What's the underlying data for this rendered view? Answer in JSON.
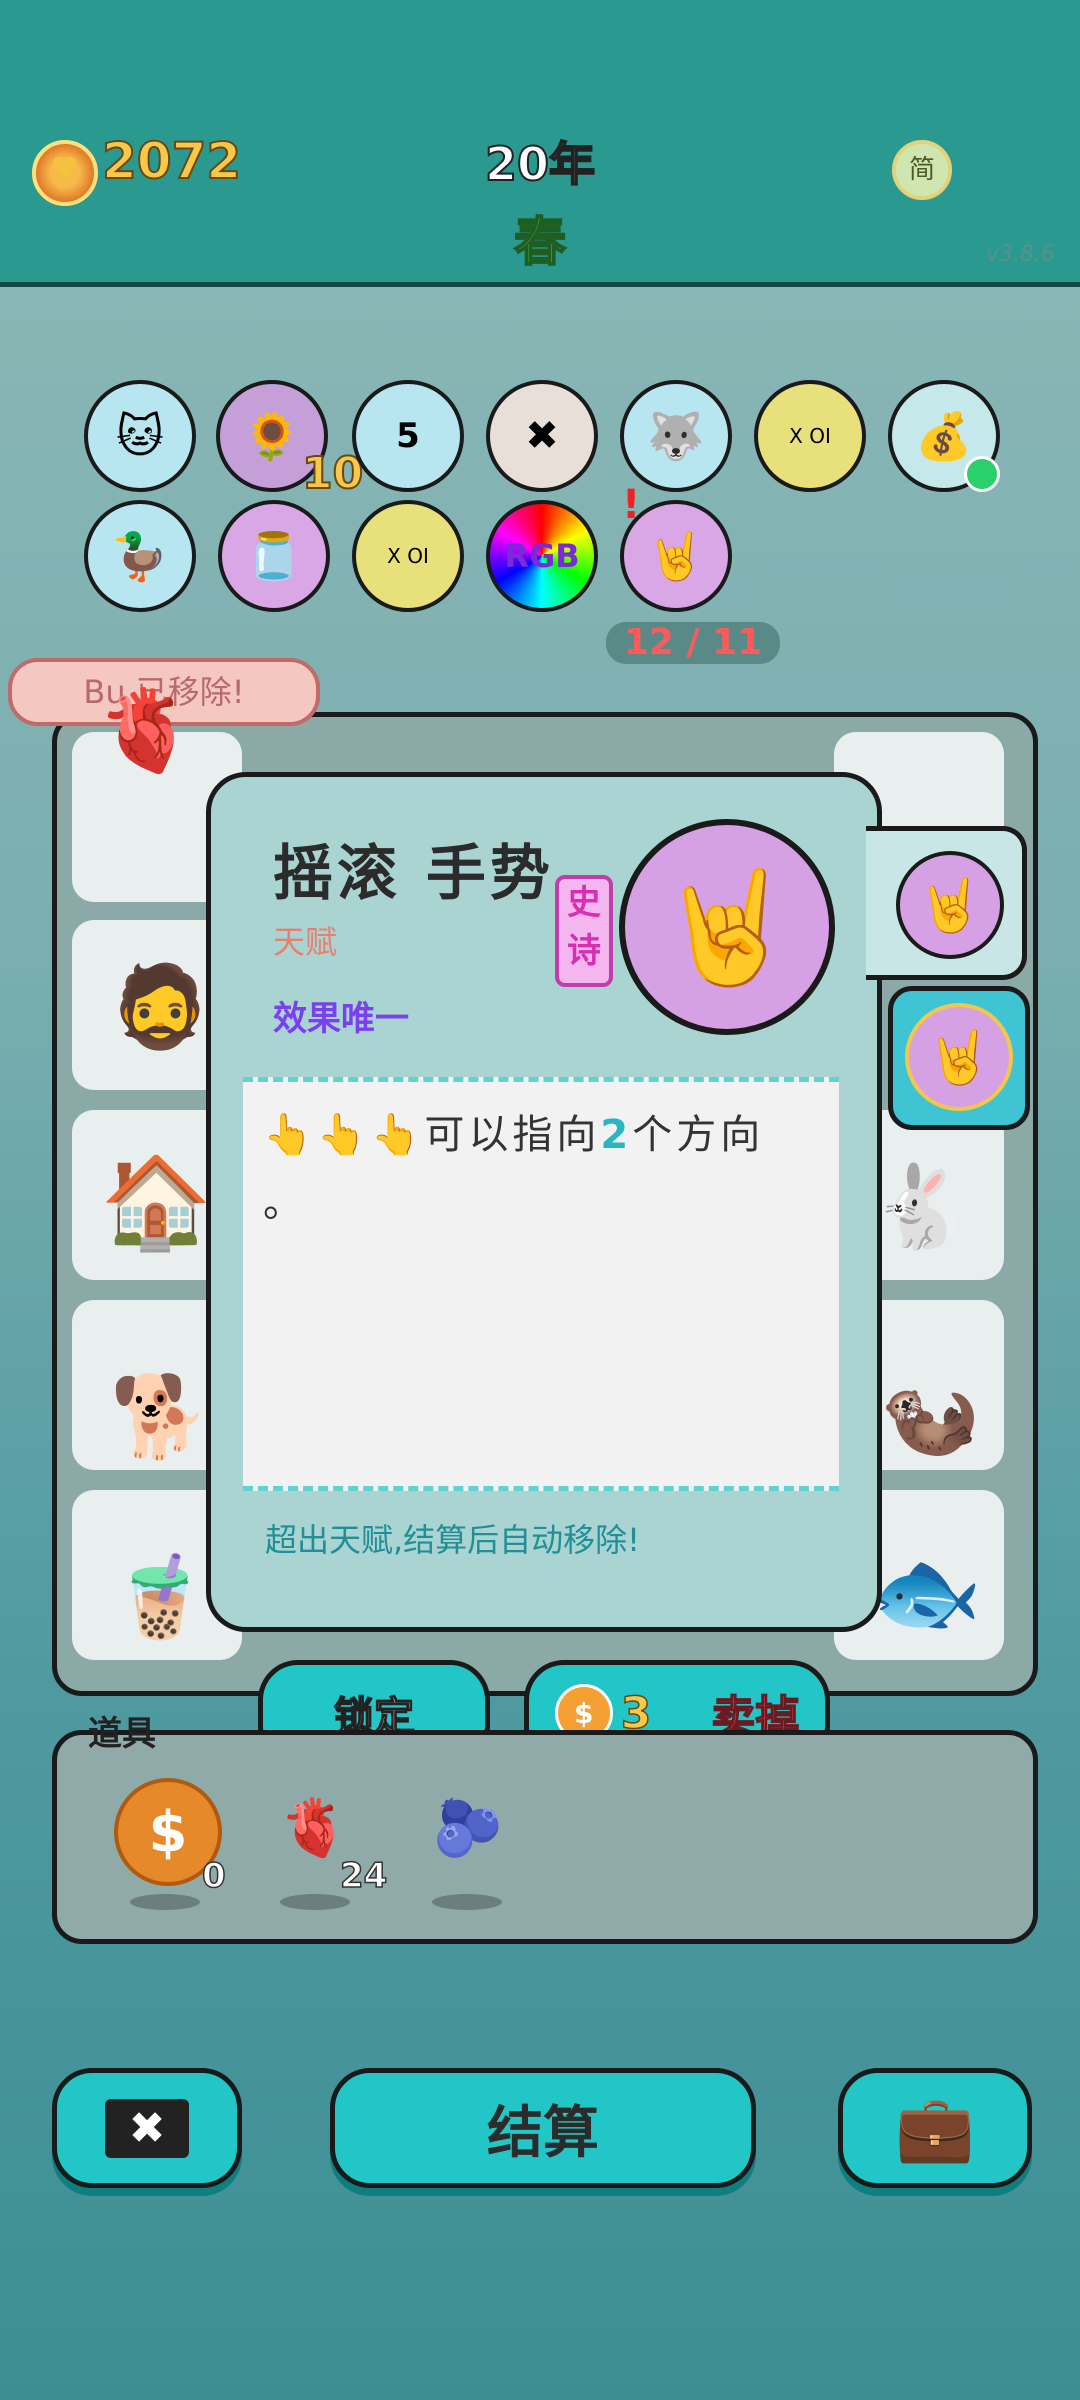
{
  "header": {
    "coins": "2072",
    "year": "20年",
    "season": "春",
    "lang_toggle": "简",
    "version": "v3.8.6"
  },
  "relics": {
    "row1": [
      {
        "icon": "sunflower-cat-icon",
        "glyph": "🐱"
      },
      {
        "icon": "sunflower-cats-icon",
        "glyph": "🌻",
        "badge": "10"
      },
      {
        "icon": "calendar-icon",
        "glyph": "5"
      },
      {
        "icon": "delete-key-icon",
        "glyph": "✖"
      },
      {
        "icon": "husky-icon",
        "glyph": "🐺"
      },
      {
        "icon": "chip-icon",
        "glyph": "X OI"
      },
      {
        "icon": "sack-icon",
        "glyph": "💰"
      }
    ],
    "row2": [
      {
        "icon": "rice-cooker-duck-icon",
        "glyph": "🦆"
      },
      {
        "icon": "jar-icon",
        "glyph": "🫙"
      },
      {
        "icon": "chip-icon",
        "glyph": "X OI"
      },
      {
        "icon": "rgb-icon",
        "glyph": "RGB"
      },
      {
        "icon": "rock-hand-icon",
        "glyph": "🤘"
      }
    ]
  },
  "slot_count": "12 / 11",
  "bubble": "Bu 已移除!",
  "popup": {
    "title": "摇滚 手势",
    "subtitle": "天赋",
    "effect": "效果唯一",
    "rarity": "史诗",
    "desc_prefix": "👆👆👆可以指向",
    "desc_num": "2",
    "desc_suffix": "个方向",
    "desc_end": "。",
    "footer": "超出天赋,结算后自动移除!"
  },
  "buttons": {
    "lock": "锁定",
    "sell_price": "3",
    "sell": "卖掉",
    "settle": "结算",
    "coin_sym": "$"
  },
  "items": {
    "label": "道具",
    "list": [
      {
        "icon": "coin-icon",
        "glyph": "$",
        "count": "0"
      },
      {
        "icon": "liver-icon",
        "glyph": "🫀",
        "count": "24"
      },
      {
        "icon": "blueberry-icon",
        "glyph": "🫐",
        "count": ""
      }
    ]
  },
  "colors": {
    "teal": "#2a9a90",
    "accent": "#22c6c6",
    "epic": "#d82fb2"
  }
}
